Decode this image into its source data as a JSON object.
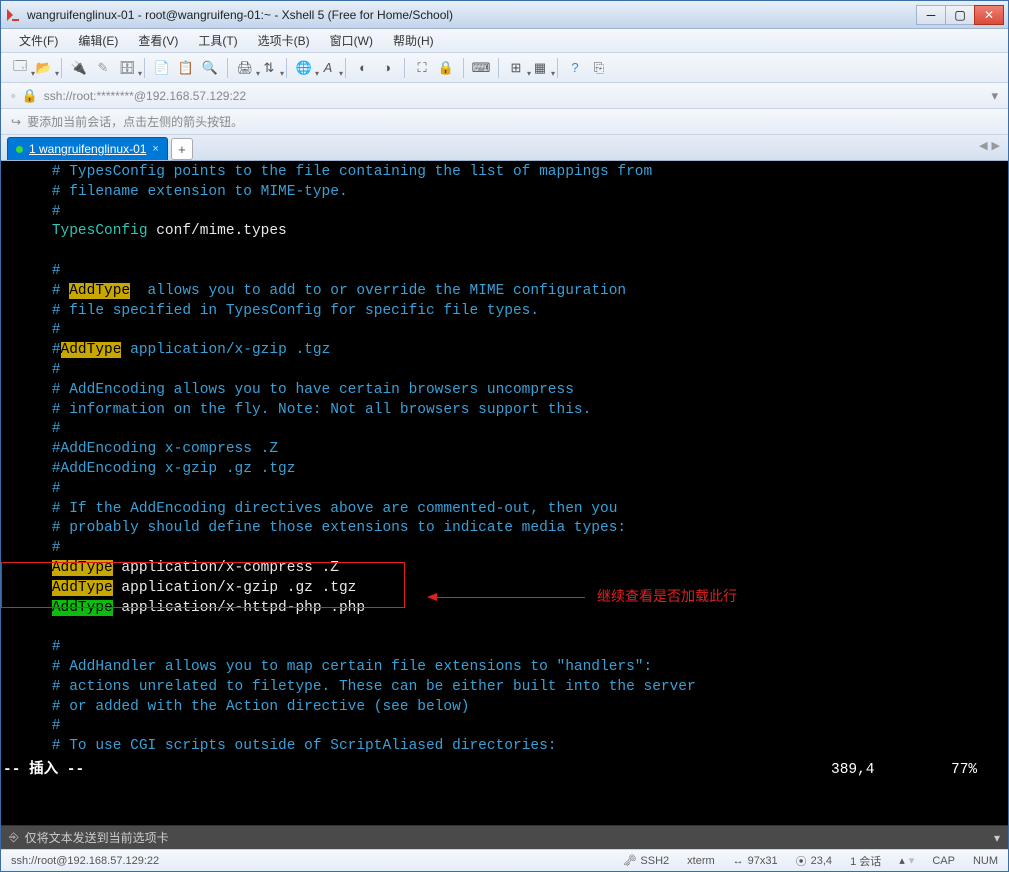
{
  "window": {
    "title": "wangruifenglinux-01 - root@wangruifeng-01:~ - Xshell 5 (Free for Home/School)"
  },
  "menubar": {
    "items": [
      "文件(F)",
      "编辑(E)",
      "查看(V)",
      "工具(T)",
      "选项卡(B)",
      "窗口(W)",
      "帮助(H)"
    ]
  },
  "address": {
    "text": "ssh://root:********@192.168.57.129:22"
  },
  "hint": {
    "text": "要添加当前会话，点击左侧的箭头按钮。"
  },
  "tab": {
    "label": "1 wangruifenglinux-01"
  },
  "terminal": {
    "lines": [
      {
        "t": "comment",
        "text": "# TypesConfig points to the file containing the list of mappings from"
      },
      {
        "t": "comment",
        "text": "# filename extension to MIME-type."
      },
      {
        "t": "comment",
        "text": "#"
      },
      {
        "t": "mixed",
        "parts": [
          {
            "c": "key",
            "v": "TypesConfig"
          },
          {
            "c": "plain",
            "v": " conf/mime.types"
          }
        ]
      },
      {
        "t": "blank"
      },
      {
        "t": "comment",
        "text": "#"
      },
      {
        "t": "mixed",
        "parts": [
          {
            "c": "comment",
            "v": "# "
          },
          {
            "c": "hl",
            "v": "AddType"
          },
          {
            "c": "comment",
            "v": "  allows you to add to or override the MIME configuration"
          }
        ]
      },
      {
        "t": "comment",
        "text": "# file specified in TypesConfig for specific file types."
      },
      {
        "t": "comment",
        "text": "#"
      },
      {
        "t": "mixed",
        "parts": [
          {
            "c": "comment",
            "v": "#"
          },
          {
            "c": "hl",
            "v": "AddType"
          },
          {
            "c": "comment",
            "v": " application/x-gzip .tgz"
          }
        ]
      },
      {
        "t": "comment",
        "text": "#"
      },
      {
        "t": "comment",
        "text": "# AddEncoding allows you to have certain browsers uncompress"
      },
      {
        "t": "comment",
        "text": "# information on the fly. Note: Not all browsers support this."
      },
      {
        "t": "comment",
        "text": "#"
      },
      {
        "t": "comment",
        "text": "#AddEncoding x-compress .Z"
      },
      {
        "t": "comment",
        "text": "#AddEncoding x-gzip .gz .tgz"
      },
      {
        "t": "comment",
        "text": "#"
      },
      {
        "t": "comment",
        "text": "# If the AddEncoding directives above are commented-out, then you"
      },
      {
        "t": "comment",
        "text": "# probably should define those extensions to indicate media types:"
      },
      {
        "t": "comment",
        "text": "#"
      },
      {
        "t": "mixed",
        "parts": [
          {
            "c": "hl",
            "v": "AddType"
          },
          {
            "c": "plain",
            "v": " application/x-compress .Z"
          }
        ]
      },
      {
        "t": "mixed",
        "parts": [
          {
            "c": "hl",
            "v": "AddType"
          },
          {
            "c": "plain",
            "v": " application/x-gzip .gz .tgz"
          }
        ]
      },
      {
        "t": "mixed",
        "parts": [
          {
            "c": "hlcur",
            "v": "AddType"
          },
          {
            "c": "plain",
            "v": " application/x-httpd-php .php"
          }
        ]
      },
      {
        "t": "blank"
      },
      {
        "t": "comment",
        "text": "#"
      },
      {
        "t": "comment",
        "text": "# AddHandler allows you to map certain file extensions to \"handlers\":"
      },
      {
        "t": "comment",
        "text": "# actions unrelated to filetype. These can be either built into the server"
      },
      {
        "t": "comment",
        "text": "# or added with the Action directive (see below)"
      },
      {
        "t": "comment",
        "text": "#"
      },
      {
        "t": "comment",
        "text": "# To use CGI scripts outside of ScriptAliased directories:"
      }
    ],
    "mode": "-- 插入 --",
    "position": "389,4",
    "percent": "77%"
  },
  "annotation": {
    "text": "继续查看是否加载此行"
  },
  "inputbar": {
    "text": "仅将文本发送到当前选项卡"
  },
  "statusbar": {
    "conn": "ssh://root@192.168.57.129:22",
    "ssh": "SSH2",
    "term": "xterm",
    "size": "97x31",
    "cursor": "23,4",
    "sess": "1 会话",
    "cap": "CAP",
    "num": "NUM"
  }
}
